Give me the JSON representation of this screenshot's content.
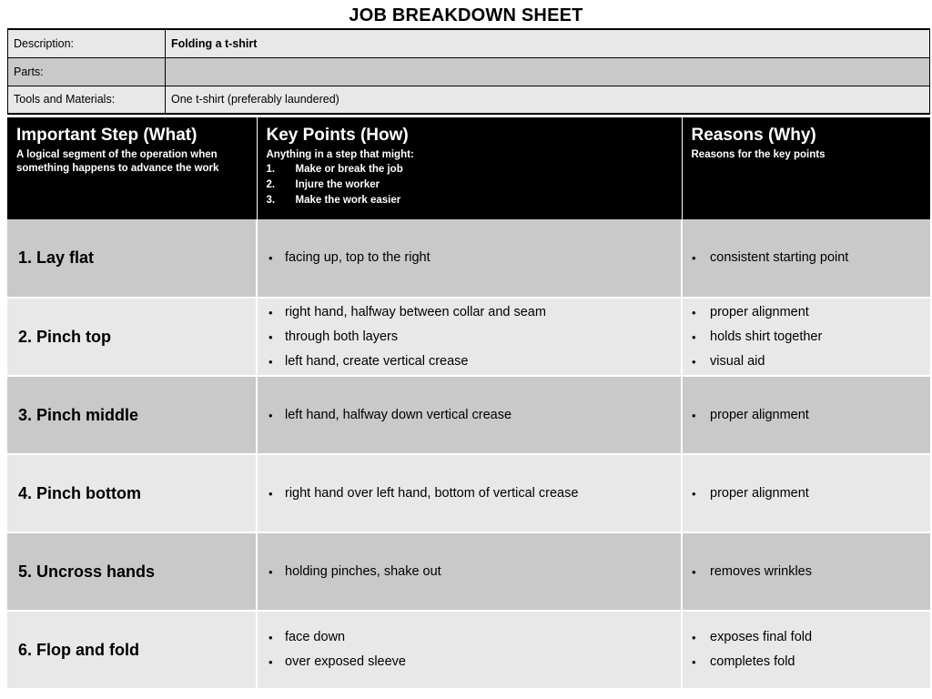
{
  "document": {
    "title": "JOB BREAKDOWN SHEET"
  },
  "info": {
    "rows": [
      {
        "label": "Description:",
        "value": "Folding a t-shirt",
        "shaded": false,
        "bold": true
      },
      {
        "label": "Parts:",
        "value": "",
        "shaded": true,
        "bold": false
      },
      {
        "label": "Tools and Materials:",
        "value": "One t-shirt (preferably laundered)",
        "shaded": false,
        "bold": false
      }
    ]
  },
  "columns": {
    "step": {
      "title": "Important Step (What)",
      "subtitle": "A logical segment of the operation when something happens to advance the work"
    },
    "key_points": {
      "title": "Key Points (How)",
      "subtitle": "Anything in a step that might:",
      "list": [
        {
          "num": "1.",
          "text": "Make or break the job"
        },
        {
          "num": "2.",
          "text": "Injure the worker"
        },
        {
          "num": "3.",
          "text": "Make the work easier"
        }
      ]
    },
    "reasons": {
      "title": "Reasons (Why)",
      "subtitle": "Reasons for the key points"
    }
  },
  "rows": [
    {
      "step": "1. Lay flat",
      "key_points": [
        "facing up, top to the right"
      ],
      "reasons": [
        "consistent starting point"
      ]
    },
    {
      "step": "2. Pinch top",
      "key_points": [
        "right hand, halfway between collar and seam",
        "through both layers",
        "left hand, create vertical crease"
      ],
      "reasons": [
        "proper alignment",
        "holds shirt together",
        "visual aid"
      ]
    },
    {
      "step": "3. Pinch middle",
      "key_points": [
        "left hand, halfway down vertical crease"
      ],
      "reasons": [
        "proper alignment"
      ]
    },
    {
      "step": "4. Pinch bottom",
      "key_points": [
        "right hand over left hand, bottom of vertical crease"
      ],
      "reasons": [
        "proper alignment"
      ]
    },
    {
      "step": "5. Uncross hands",
      "key_points": [
        "holding pinches, shake out"
      ],
      "reasons": [
        "removes wrinkles"
      ]
    },
    {
      "step": "6. Flop and fold",
      "key_points": [
        "face down",
        "over exposed sleeve"
      ],
      "reasons": [
        "exposes final fold",
        "completes fold"
      ]
    }
  ],
  "bullet_glyph": "•",
  "colors": {
    "header_band": "#000000",
    "header_text": "#ffffff",
    "row_shaded": "#c9c9c9",
    "row_plain": "#e8e8e8",
    "page_background": "#ffffff",
    "text": "#000000"
  }
}
